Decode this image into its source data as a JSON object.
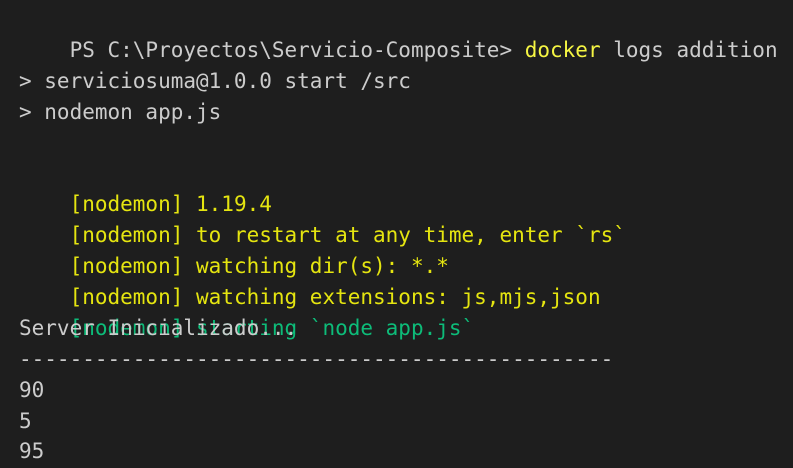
{
  "terminal": {
    "prompt": {
      "path": "PS C:\\Proyectos\\Servicio-Composite> ",
      "command": "docker",
      "args": " logs addition"
    },
    "npm_lines": [
      "> serviciosuma@1.0.0 start /src",
      "> nodemon app.js"
    ],
    "nodemon_lines": [
      {
        "tag": "[nodemon]",
        "text": " 1.19.4"
      },
      {
        "tag": "[nodemon]",
        "text": " to restart at any time, enter `rs`"
      },
      {
        "tag": "[nodemon]",
        "text": " watching dir(s): *.*"
      },
      {
        "tag": "[nodemon]",
        "text": " watching extensions: js,mjs,json"
      },
      {
        "tag": "[nodemon]",
        "text": " starting `node app.js`"
      }
    ],
    "server_line": "Server Inicializado...",
    "divider": "-----------------------------------------------",
    "values": [
      "90",
      "5",
      "95"
    ]
  },
  "colors": {
    "background": "#1e1e1e",
    "default_text": "#cccccc",
    "nodemon_yellow": "#e5e510",
    "nodemon_green": "#0dbc79",
    "command_yellow": "#f5f543"
  }
}
